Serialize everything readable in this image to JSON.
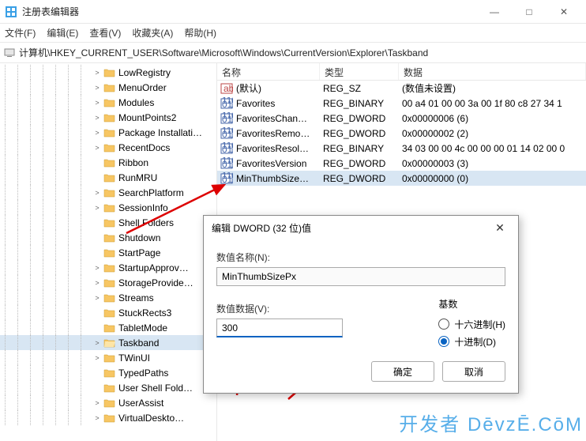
{
  "window": {
    "title": "注册表编辑器",
    "min": "—",
    "max": "□",
    "close": "✕"
  },
  "menubar": [
    "文件(F)",
    "编辑(E)",
    "查看(V)",
    "收藏夹(A)",
    "帮助(H)"
  ],
  "address": "计算机\\HKEY_CURRENT_USER\\Software\\Microsoft\\Windows\\CurrentVersion\\Explorer\\Taskband",
  "tree": [
    {
      "label": "LowRegistry",
      "open": false,
      "sel": false,
      "chev": ">"
    },
    {
      "label": "MenuOrder",
      "open": false,
      "sel": false,
      "chev": ">"
    },
    {
      "label": "Modules",
      "open": false,
      "sel": false,
      "chev": ">"
    },
    {
      "label": "MountPoints2",
      "open": false,
      "sel": false,
      "chev": ">"
    },
    {
      "label": "Package Installati…",
      "open": false,
      "sel": false,
      "chev": ">"
    },
    {
      "label": "RecentDocs",
      "open": false,
      "sel": false,
      "chev": ">"
    },
    {
      "label": "Ribbon",
      "open": false,
      "sel": false,
      "chev": ""
    },
    {
      "label": "RunMRU",
      "open": false,
      "sel": false,
      "chev": ""
    },
    {
      "label": "SearchPlatform",
      "open": false,
      "sel": false,
      "chev": ">"
    },
    {
      "label": "SessionInfo",
      "open": false,
      "sel": false,
      "chev": ">"
    },
    {
      "label": "Shell Folders",
      "open": false,
      "sel": false,
      "chev": ""
    },
    {
      "label": "Shutdown",
      "open": false,
      "sel": false,
      "chev": ""
    },
    {
      "label": "StartPage",
      "open": false,
      "sel": false,
      "chev": ""
    },
    {
      "label": "StartupApprov…",
      "open": false,
      "sel": false,
      "chev": ">"
    },
    {
      "label": "StorageProvide…",
      "open": false,
      "sel": false,
      "chev": ">"
    },
    {
      "label": "Streams",
      "open": false,
      "sel": false,
      "chev": ">"
    },
    {
      "label": "StuckRects3",
      "open": false,
      "sel": false,
      "chev": ""
    },
    {
      "label": "TabletMode",
      "open": false,
      "sel": false,
      "chev": ""
    },
    {
      "label": "Taskband",
      "open": true,
      "sel": true,
      "chev": ">"
    },
    {
      "label": "TWinUI",
      "open": false,
      "sel": false,
      "chev": ">"
    },
    {
      "label": "TypedPaths",
      "open": false,
      "sel": false,
      "chev": ""
    },
    {
      "label": "User Shell Fold…",
      "open": false,
      "sel": false,
      "chev": ""
    },
    {
      "label": "UserAssist",
      "open": false,
      "sel": false,
      "chev": ">"
    },
    {
      "label": "VirtualDeskto…",
      "open": false,
      "sel": false,
      "chev": ">"
    }
  ],
  "columns": {
    "name": "名称",
    "type": "类型",
    "data": "数据"
  },
  "values": [
    {
      "icon": "sz",
      "name": "(默认)",
      "type": "REG_SZ",
      "data": "(数值未设置)",
      "sel": false
    },
    {
      "icon": "bin",
      "name": "Favorites",
      "type": "REG_BINARY",
      "data": "00 a4 01 00 00 3a 00 1f 80 c8 27 34 1",
      "sel": false
    },
    {
      "icon": "bin",
      "name": "FavoritesChan…",
      "type": "REG_DWORD",
      "data": "0x00000006 (6)",
      "sel": false
    },
    {
      "icon": "bin",
      "name": "FavoritesRemo…",
      "type": "REG_DWORD",
      "data": "0x00000002 (2)",
      "sel": false
    },
    {
      "icon": "bin",
      "name": "FavoritesResol…",
      "type": "REG_BINARY",
      "data": "34 03 00 00 4c 00 00 00 01 14 02 00 0",
      "sel": false
    },
    {
      "icon": "bin",
      "name": "FavoritesVersion",
      "type": "REG_DWORD",
      "data": "0x00000003 (3)",
      "sel": false
    },
    {
      "icon": "bin",
      "name": "MinThumbSize…",
      "type": "REG_DWORD",
      "data": "0x00000000 (0)",
      "sel": true
    }
  ],
  "dialog": {
    "title": "编辑 DWORD (32 位)值",
    "name_label": "数值名称(N):",
    "name_value": "MinThumbSizePx",
    "data_label": "数值数据(V):",
    "data_value": "300",
    "base_label": "基数",
    "hex_label": "十六进制(H)",
    "dec_label": "十进制(D)",
    "ok": "确定",
    "cancel": "取消"
  },
  "watermark": "开发者 DēvzĒ.CōM"
}
